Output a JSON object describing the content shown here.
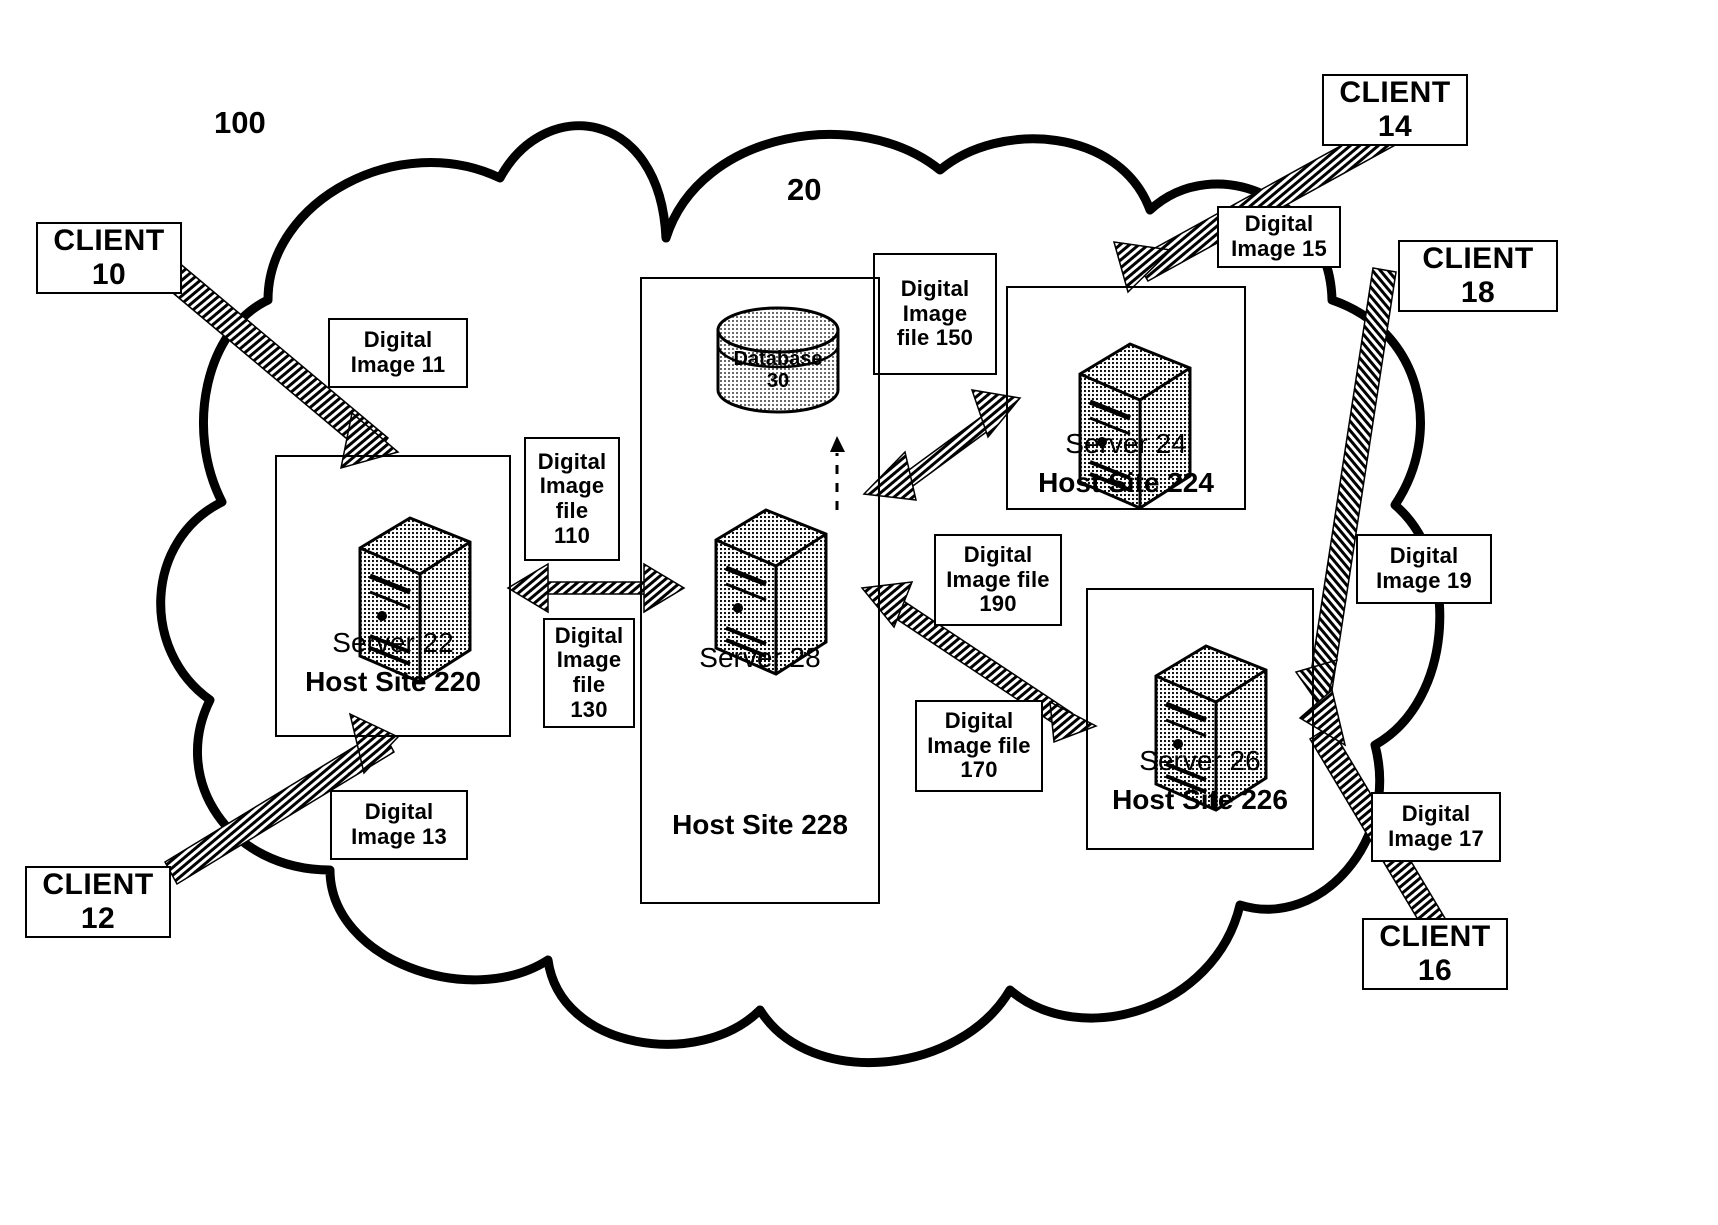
{
  "diagram": {
    "system_ref": "100",
    "network_ref": "20",
    "network_label": "cloud-network"
  },
  "clients": [
    {
      "name": "CLIENT",
      "ref": "10"
    },
    {
      "name": "CLIENT",
      "ref": "12"
    },
    {
      "name": "CLIENT",
      "ref": "14"
    },
    {
      "name": "CLIENT",
      "ref": "16"
    },
    {
      "name": "CLIENT",
      "ref": "18"
    }
  ],
  "digital_images": [
    {
      "line1": "Digital",
      "line2": "Image  11"
    },
    {
      "line1": "Digital",
      "line2": "Image  13"
    },
    {
      "line1": "Digital",
      "line2": "Image 15"
    },
    {
      "line1": "Digital",
      "line2": "Image  17"
    },
    {
      "line1": "Digital",
      "line2": "Image 19"
    }
  ],
  "digital_image_files": [
    {
      "line1": "Digital",
      "line2": "Image",
      "line3": "file",
      "line4": "110"
    },
    {
      "line1": "Digital",
      "line2": "Image",
      "line3": "file",
      "line4": "130"
    },
    {
      "line1": "Digital",
      "line2": "Image",
      "line3": "file 150",
      "line4": ""
    },
    {
      "line1": "Digital",
      "line2": "Image file",
      "line3": "170",
      "line4": ""
    },
    {
      "line1": "Digital",
      "line2": "Image file",
      "line3": "190",
      "line4": ""
    }
  ],
  "host_sites": [
    {
      "server": "Server 22",
      "site": "Host Site 220"
    },
    {
      "server": "Server 24",
      "site": "Host Site 224"
    },
    {
      "server": "Server 26",
      "site": "Host Site 226"
    },
    {
      "server": "Server 28",
      "site": "Host Site 228"
    }
  ],
  "database": {
    "name": "Database",
    "ref": "30"
  },
  "colors": {
    "stroke": "#000000",
    "fill": "#ffffff",
    "hatch": "#000000"
  }
}
